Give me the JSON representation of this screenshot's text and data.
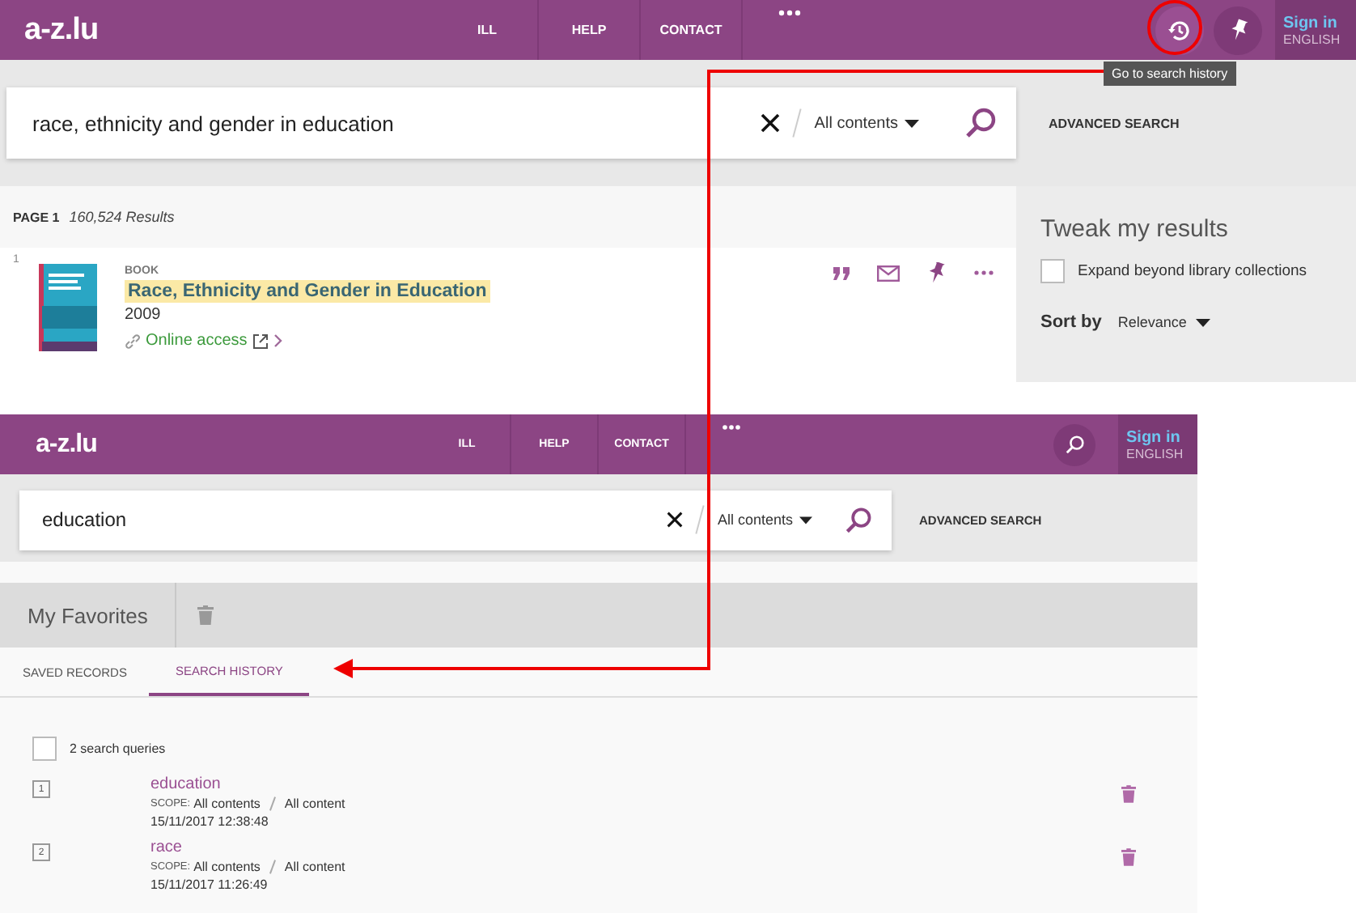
{
  "top": {
    "header": {
      "logo": "a-z.lu",
      "nav": [
        "ILL",
        "HELP",
        "CONTACT"
      ],
      "actions": [
        {
          "kind": "history",
          "highlighted": true
        },
        {
          "kind": "pin",
          "highlighted": false
        }
      ],
      "sign_in": "Sign in",
      "language": "ENGLISH",
      "tooltip": "Go to search history"
    },
    "search": {
      "value": "race, ethnicity and gender in education",
      "scope": "All contents",
      "advanced": "ADVANCED SEARCH"
    },
    "results": {
      "page": "PAGE 1",
      "count": "160,524 Results",
      "items": [
        {
          "index": "1",
          "type": "BOOK",
          "title": "Race, Ethnicity and Gender in Education",
          "year": "2009",
          "access": "Online access"
        }
      ]
    },
    "tweak": {
      "title": "Tweak my results",
      "checkbox": {
        "label": "Expand beyond library collections",
        "checked": false
      },
      "sort_label": "Sort by",
      "sort_value": "Relevance"
    }
  },
  "bottom": {
    "header": {
      "logo": "a-z.lu",
      "nav": [
        "ILL",
        "HELP",
        "CONTACT"
      ],
      "actions": [
        {
          "kind": "search",
          "highlighted": false
        }
      ],
      "sign_in": "Sign in",
      "language": "ENGLISH"
    },
    "search": {
      "value": "education",
      "scope": "All contents",
      "advanced": "ADVANCED SEARCH"
    },
    "favorites": {
      "title": "My Favorites",
      "tabs": [
        {
          "label": "SAVED RECORDS",
          "selected": false
        },
        {
          "label": "SEARCH HISTORY",
          "selected": true
        }
      ],
      "select_all": {
        "label": "2 search queries",
        "checked": false
      },
      "queries": [
        {
          "index": "1",
          "query": "education",
          "scope_label": "SCOPE:",
          "scope": "All contents",
          "collection": "All content",
          "timestamp": "15/11/2017 12:38:48"
        },
        {
          "index": "2",
          "query": "race",
          "scope_label": "SCOPE:",
          "scope": "All contents",
          "collection": "All content",
          "timestamp": "15/11/2017 11:26:49"
        }
      ]
    }
  }
}
